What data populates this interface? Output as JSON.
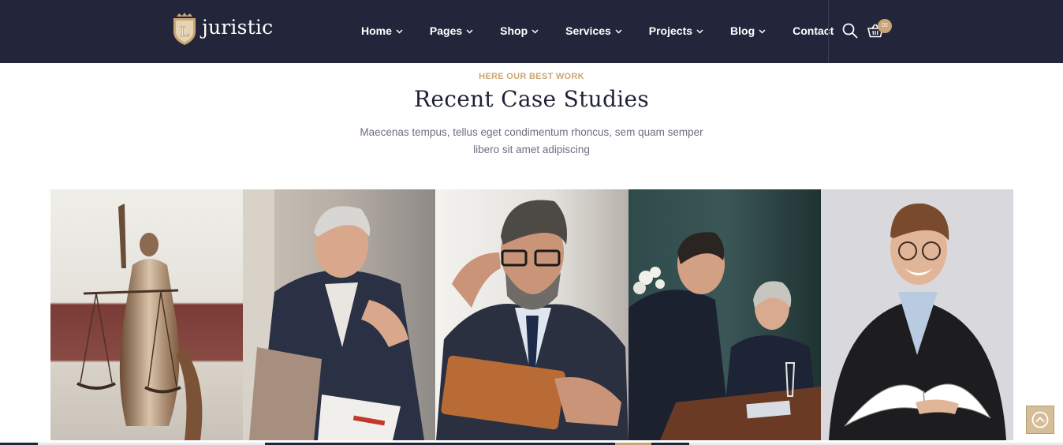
{
  "header": {
    "logo": {
      "text": "juristic",
      "badge_letter": "L"
    },
    "nav": [
      {
        "label": "Home",
        "has_dropdown": true
      },
      {
        "label": "Pages",
        "has_dropdown": true
      },
      {
        "label": "Shop",
        "has_dropdown": true
      },
      {
        "label": "Services",
        "has_dropdown": true
      },
      {
        "label": "Projects",
        "has_dropdown": true
      },
      {
        "label": "Blog",
        "has_dropdown": true
      },
      {
        "label": "Contact",
        "has_dropdown": false
      }
    ],
    "cart_count": "02",
    "icons": {
      "search": "search-icon",
      "cart": "basket-icon"
    }
  },
  "section": {
    "eyebrow": "HERE OUR BEST WORK",
    "title": "Recent Case Studies",
    "subtitle": "Maecenas tempus, tellus eget condimentum rhoncus, sem quam semper libero sit amet adipiscing"
  },
  "gallery": [
    {
      "subject": "lady-justice-statue"
    },
    {
      "subject": "lawyer-at-laptop"
    },
    {
      "subject": "lawyer-reading-tablet"
    },
    {
      "subject": "lawyers-in-meeting"
    },
    {
      "subject": "graduate-holding-book"
    }
  ],
  "colors": {
    "header_bg": "#23263a",
    "accent": "#c9a677",
    "title": "#1f2235",
    "body_text": "#6c6f80"
  },
  "back_to_top": {
    "icon": "arrow-up-circle-icon"
  }
}
